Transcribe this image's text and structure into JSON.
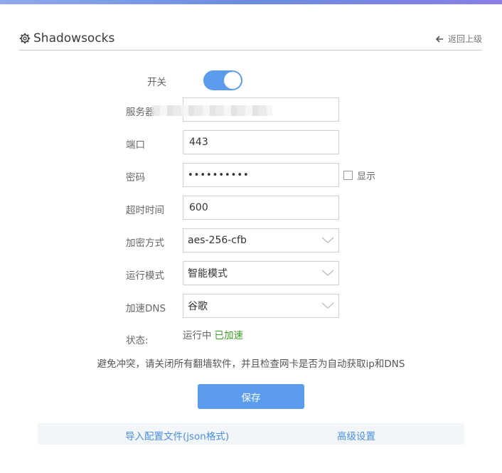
{
  "header": {
    "title": "Shadowsocks",
    "back_label": "返回上级"
  },
  "form": {
    "switch": {
      "label": "开关",
      "on": true
    },
    "server": {
      "label": "服务器",
      "value": ""
    },
    "port": {
      "label": "端口",
      "value": "443"
    },
    "password": {
      "label": "密码",
      "masked_value": "••••••••••",
      "show_label": "显示",
      "show_checked": false
    },
    "timeout": {
      "label": "超时时间",
      "value": "600"
    },
    "encryption": {
      "label": "加密方式",
      "value": "aes-256-cfb"
    },
    "run_mode": {
      "label": "运行模式",
      "value": "智能模式"
    },
    "dns": {
      "label": "加速DNS",
      "value": "谷歌"
    },
    "status": {
      "label": "状态:",
      "running": "运行中",
      "accelerated": "已加速"
    }
  },
  "notice": "避免冲突，请关闭所有翻墙软件，并且检查网卡是否为自动获取ip和DNS",
  "save_label": "保存",
  "footer": {
    "import_label": "导入配置文件(json格式)",
    "advanced_label": "高级设置"
  },
  "colors": {
    "accent": "#5b9cec",
    "status_ok": "#3a9d23",
    "link": "#4a8fe0"
  }
}
